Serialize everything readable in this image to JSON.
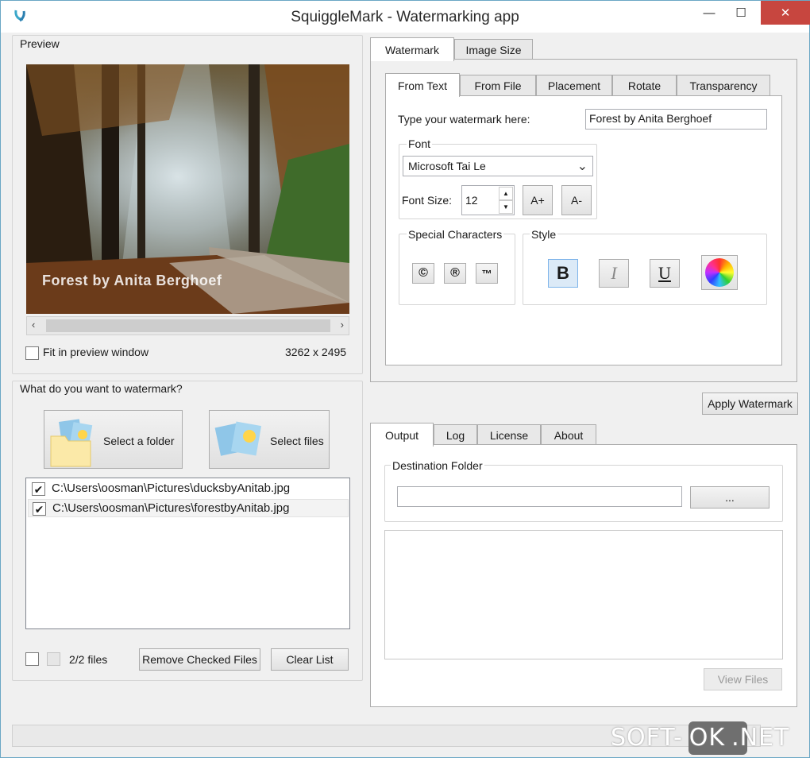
{
  "window": {
    "title": "SquiggleMark - Watermarking app",
    "minimize": "—",
    "maximize": "☐",
    "close": "✕"
  },
  "preview": {
    "label": "Preview",
    "overlay_text": "Forest by Anita Berghoef",
    "fit_label": "Fit in preview window",
    "dimensions": "3262 x 2495",
    "scroll_left": "‹",
    "scroll_right": "›"
  },
  "source": {
    "label": "What do you want to watermark?",
    "select_folder": "Select a folder",
    "select_files": "Select files",
    "files": [
      {
        "path": "C:\\Users\\oosman\\Pictures\\ducksbyAnitab.jpg",
        "checked": true
      },
      {
        "path": "C:\\Users\\oosman\\Pictures\\forestbyAnitab.jpg",
        "checked": true
      }
    ],
    "count": "2/2 files",
    "remove_checked": "Remove Checked Files",
    "clear_list": "Clear List"
  },
  "top_tabs": [
    "Watermark",
    "Image Size"
  ],
  "sub_tabs": [
    "From Text",
    "From File",
    "Placement",
    "Rotate",
    "Transparency"
  ],
  "from_text": {
    "prompt": "Type your watermark here:",
    "value": "Forest by Anita Berghoef",
    "font_group": "Font",
    "font_name": "Microsoft Tai Le",
    "font_size_label": "Font Size:",
    "font_size": "12",
    "increase": "A+",
    "decrease": "A-",
    "special_group": "Special Characters",
    "special": [
      "©",
      "®",
      "™"
    ],
    "style_group": "Style",
    "bold": "B",
    "italic": "I",
    "underline": "U"
  },
  "apply_button": "Apply Watermark",
  "output_tabs": [
    "Output",
    "Log",
    "License",
    "About"
  ],
  "output": {
    "dest_label": "Destination Folder",
    "dest_value": "",
    "browse": "...",
    "view_files": "View Files"
  },
  "overlay_brand": {
    "left": "SOFT-",
    "mid": "OK",
    "right": ".NET"
  }
}
